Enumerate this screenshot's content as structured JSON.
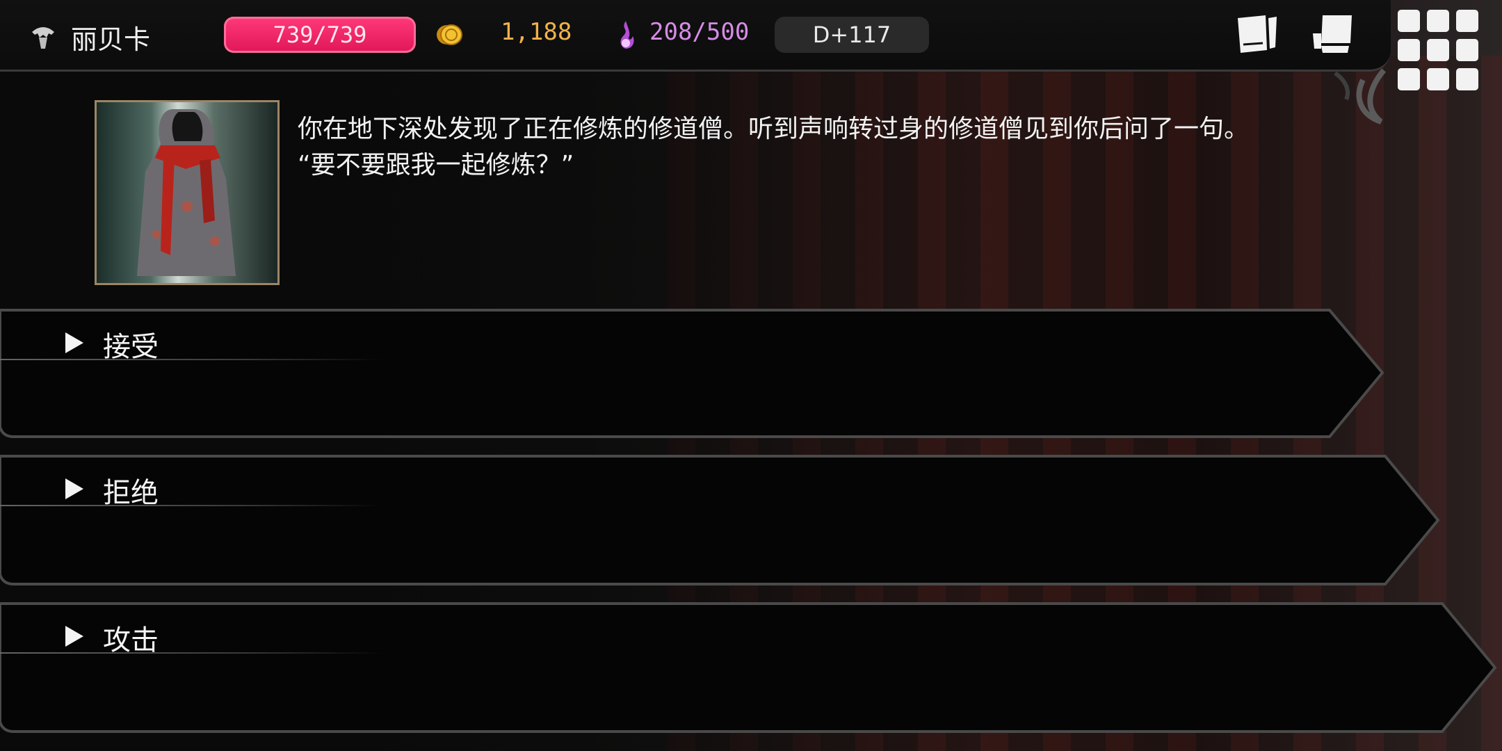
{
  "top_bar": {
    "character_name": "丽贝卡",
    "hp": "739/739",
    "gold": "1,188",
    "souls": "208/500",
    "day": "D+117",
    "icons": [
      "skull-icon",
      "coin-icon",
      "soul-flame-icon",
      "journal-icon",
      "map-icon",
      "menu-grid-icon"
    ]
  },
  "event": {
    "text_line1": "你在地下深处发现了正在修炼的修道僧。听到声响转过身的修道僧见到你后问了一句。",
    "text_line2": "“要不要跟我一起修炼？”"
  },
  "choices": [
    {
      "label": "接受"
    },
    {
      "label": "拒绝"
    },
    {
      "label": "攻击"
    }
  ],
  "colors": {
    "hp": "#e01658",
    "gold": "#f0b24a",
    "souls": "#d68ce6",
    "frame": "#9c8664"
  }
}
